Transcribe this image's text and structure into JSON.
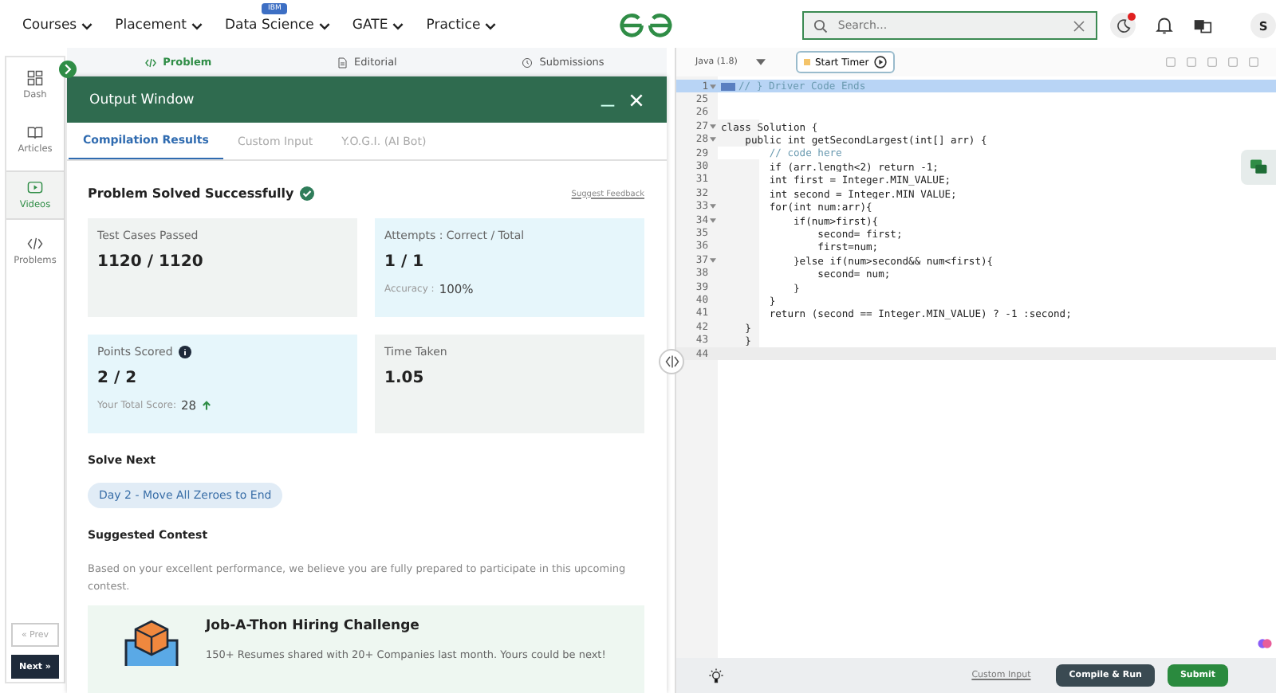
{
  "nav": {
    "items": [
      {
        "label": "Courses"
      },
      {
        "label": "Placement"
      },
      {
        "label": "Data Science",
        "badge": "IBM"
      },
      {
        "label": "GATE"
      },
      {
        "label": "Practice"
      }
    ],
    "search": {
      "placeholder": "Search..."
    },
    "avatar": "S",
    "notification_dot": true
  },
  "sidebar": {
    "items": [
      {
        "label": "Dash",
        "selected": false
      },
      {
        "label": "Articles",
        "selected": false
      },
      {
        "label": "Videos",
        "selected": true
      },
      {
        "label": "Problems",
        "selected": false
      }
    ],
    "prev": "« Prev",
    "next": "Next »"
  },
  "problem_tabs": [
    {
      "label": "Problem",
      "selected": true
    },
    {
      "label": "Editorial",
      "selected": false
    },
    {
      "label": "Submissions",
      "selected": false
    }
  ],
  "output_window": {
    "title": "Output Window",
    "tabs": [
      {
        "label": "Compilation Results",
        "selected": true
      },
      {
        "label": "Custom Input",
        "selected": false
      },
      {
        "label": "Y.O.G.I. (AI Bot)",
        "selected": false
      }
    ],
    "status": "Problem Solved Successfully",
    "feedback": "Suggest Feedback",
    "cards": [
      {
        "label": "Test Cases Passed",
        "value": "1120 / 1120",
        "color": "#f0f3f2"
      },
      {
        "label": "Attempts : Correct / Total",
        "value": "1 / 1",
        "color": "#e6f6fb",
        "note_label": "Accuracy :",
        "note_value": "100%"
      },
      {
        "label": "Points Scored",
        "value": "2 / 2",
        "color": "#e6f6fb",
        "note_label": "Your Total Score:",
        "note_value": "28",
        "trend_up": true,
        "info": true
      },
      {
        "label": "Time Taken",
        "value": "1.05",
        "color": "#f0f3f2"
      }
    ],
    "solve_next_heading": "Solve Next",
    "solve_next": "Day 2 - Move All Zeroes to End",
    "contest_heading": "Suggested Contest",
    "contest_text": "Based on your excellent performance, we believe you are fully prepared to participate in this upcoming contest.",
    "contest": {
      "title": "Job-A-Thon Hiring Challenge",
      "text": "150+ Resumes shared with 20+ Companies last month. Yours could be next!"
    }
  },
  "editor": {
    "language": "Java (1.8)",
    "timer": "Start Timer",
    "lines": [
      {
        "num": "1",
        "text": "// } Driver Code Ends",
        "fold": true,
        "highlighted": true,
        "kind": "comment"
      },
      {
        "num": "25"
      },
      {
        "num": "26"
      },
      {
        "num": "27",
        "text": "class Solution {",
        "fold": true,
        "kind": "code"
      },
      {
        "num": "28",
        "text": "    public int getSecondLargest(int[] arr) {",
        "fold": true,
        "kind": "code"
      },
      {
        "num": "29",
        "text": "        // code here",
        "kind": "comment"
      },
      {
        "num": "30",
        "text": "        if (arr.length<2) return -1;",
        "kind": "code"
      },
      {
        "num": "31",
        "text": "        int first = Integer.MIN_VALUE;",
        "kind": "code"
      },
      {
        "num": "32",
        "text": "        int second = Integer.MIN_VALUE;",
        "kind": "code"
      },
      {
        "num": "33",
        "text": "        for(int num:arr){",
        "fold": true,
        "kind": "code"
      },
      {
        "num": "34",
        "text": "            if(num>first){",
        "fold": true,
        "kind": "code"
      },
      {
        "num": "35",
        "text": "                second= first;",
        "kind": "code"
      },
      {
        "num": "36",
        "text": "                first=num;",
        "kind": "code"
      },
      {
        "num": "37",
        "text": "            }else if(num>second&& num<first){",
        "fold": true,
        "kind": "code"
      },
      {
        "num": "38",
        "text": "                second= num;",
        "kind": "code"
      },
      {
        "num": "39",
        "text": "            }",
        "kind": "code"
      },
      {
        "num": "40",
        "text": "        }",
        "kind": "code"
      },
      {
        "num": "41",
        "text": "        return (second == Integer.MIN_VALUE) ? -1 :second;",
        "kind": "code"
      },
      {
        "num": "42",
        "text": "    }",
        "kind": "code"
      },
      {
        "num": "43",
        "text": "    }",
        "kind": "code"
      },
      {
        "num": "44",
        "active": true
      }
    ],
    "custom_input": "Custom Input",
    "compile": "Compile & Run",
    "submit": "Submit"
  }
}
